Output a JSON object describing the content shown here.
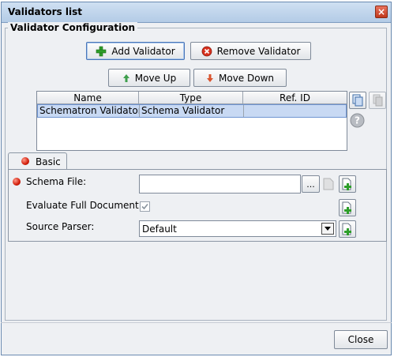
{
  "window": {
    "title": "Validators list",
    "close_glyph": "×"
  },
  "config": {
    "group_label": "Validator Configuration",
    "buttons": {
      "add": "Add Validator",
      "remove": "Remove Validator",
      "move_up": "Move Up",
      "move_down": "Move Down"
    },
    "table": {
      "columns": [
        "Name",
        "Type",
        "Ref. ID"
      ],
      "rows": [
        {
          "name": "Schematron Validator",
          "type": "Schema Validator",
          "ref_id": ""
        }
      ]
    }
  },
  "tabs": {
    "basic": "Basic"
  },
  "basic": {
    "schema_file_label": "Schema File:",
    "schema_file_value": "",
    "browse_label": "...",
    "evaluate_label": "Evaluate Full Document:",
    "evaluate_checked": true,
    "source_parser_label": "Source Parser:",
    "source_parser_value": "Default"
  },
  "footer": {
    "close_label": "Close"
  },
  "icons": {
    "add": "green-plus-icon",
    "remove": "red-x-icon",
    "up": "up-arrow-icon",
    "down": "down-arrow-icon",
    "copy": "copy-icon",
    "paste": "paste-icon",
    "help": "help-icon",
    "file": "file-icon",
    "new": "add-file-icon"
  }
}
